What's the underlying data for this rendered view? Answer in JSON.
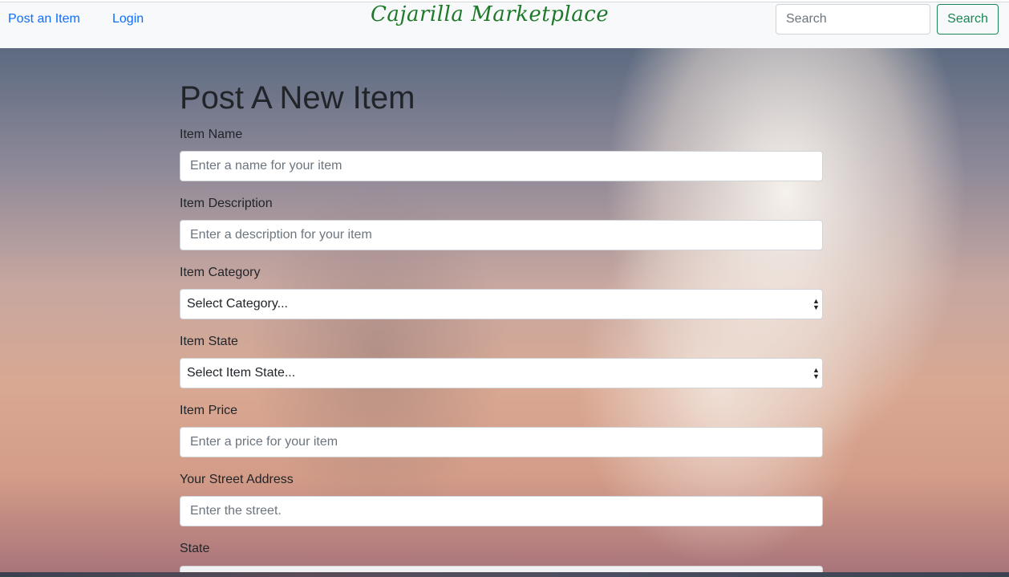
{
  "nav": {
    "post_item": "Post an Item",
    "login": "Login",
    "brand": "Cajarilla Marketplace",
    "search_placeholder": "Search",
    "search_button": "Search"
  },
  "form": {
    "title": "Post A New Item",
    "item_name": {
      "label": "Item Name",
      "placeholder": "Enter a name for your item"
    },
    "item_description": {
      "label": "Item Description",
      "placeholder": "Enter a description for your item"
    },
    "item_category": {
      "label": "Item Category",
      "selected": "Select Category..."
    },
    "item_state": {
      "label": "Item State",
      "selected": "Select Item State..."
    },
    "item_price": {
      "label": "Item Price",
      "placeholder": "Enter a price for your item"
    },
    "street_address": {
      "label": "Your Street Address",
      "placeholder": "Enter the street."
    },
    "state": {
      "label": "State"
    }
  },
  "colors": {
    "link": "#0d6efd",
    "brand": "#1e7a2a",
    "success": "#198754"
  }
}
